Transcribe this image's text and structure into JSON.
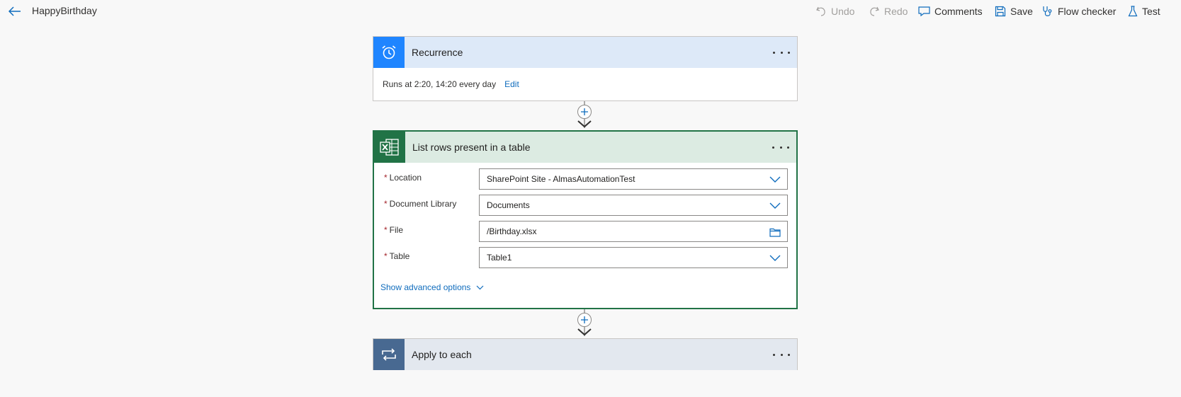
{
  "header": {
    "flow_name": "HappyBirthday",
    "commands": {
      "undo": "Undo",
      "redo": "Redo",
      "comments": "Comments",
      "save": "Save",
      "flow_checker": "Flow checker",
      "test": "Test"
    }
  },
  "steps": {
    "recurrence": {
      "title": "Recurrence",
      "summary": "Runs at 2:20, 14:20 every day",
      "edit_label": "Edit",
      "icon": "alarm-clock-icon",
      "accent": "#1f85ff"
    },
    "list_rows": {
      "title": "List rows present in a table",
      "icon": "excel-icon",
      "accent": "#217346",
      "fields": [
        {
          "label": "Location",
          "value": "SharePoint Site - AlmasAutomationTest",
          "required_mark": "*",
          "control": "dropdown"
        },
        {
          "label": "Document Library",
          "value": "Documents",
          "required_mark": "*",
          "control": "dropdown"
        },
        {
          "label": "File",
          "value": "/Birthday.xlsx",
          "required_mark": "*",
          "control": "folder-picker"
        },
        {
          "label": "Table",
          "value": "Table1",
          "required_mark": "*",
          "control": "dropdown"
        }
      ],
      "advanced_label": "Show advanced options"
    },
    "apply_to_each": {
      "title": "Apply to each",
      "icon": "loop-icon",
      "accent": "#486991"
    }
  },
  "colors": {
    "link": "#0f6cbd",
    "required": "#a4262c",
    "canvas": "#f8f8f8"
  }
}
